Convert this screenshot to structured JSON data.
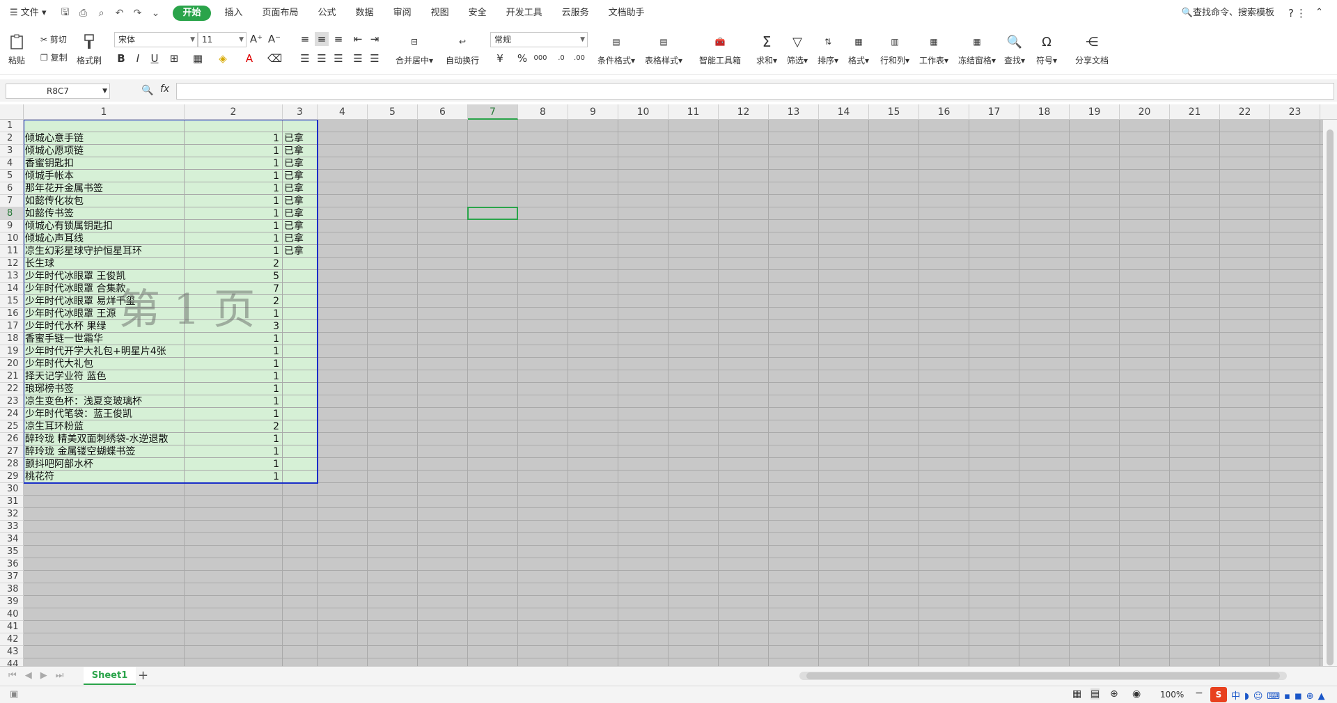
{
  "menu": {
    "file": "文件",
    "tabs": [
      "开始",
      "插入",
      "页面布局",
      "公式",
      "数据",
      "审阅",
      "视图",
      "安全",
      "开发工具",
      "云服务",
      "文档助手"
    ],
    "search": "查找命令、搜索模板"
  },
  "ribbon": {
    "paste": "粘贴",
    "cut": "剪切",
    "copy": "复制",
    "format_painter": "格式刷",
    "font": "宋体",
    "size": "11",
    "number_format": "常规",
    "merge": "合并居中",
    "wrap": "自动换行",
    "cond": "条件格式",
    "table_style": "表格样式",
    "smart": "智能工具箱",
    "sum": "求和",
    "filter": "筛选",
    "sort": "排序",
    "format": "格式",
    "rowcol": "行和列",
    "sheet": "工作表",
    "freeze": "冻结窗格",
    "find": "查找",
    "symbol": "符号",
    "share": "分享文档"
  },
  "namebox": "R8C7",
  "fx": "fx",
  "columns": [
    "1",
    "2",
    "3",
    "4",
    "5",
    "6",
    "7",
    "8",
    "9",
    "10",
    "11",
    "12",
    "13",
    "14",
    "15",
    "16",
    "17",
    "18",
    "19",
    "20",
    "21",
    "22",
    "23"
  ],
  "selected_col": "7",
  "selected_row": "8",
  "rows": [
    [
      "",
      null,
      ""
    ],
    [
      "倾城心意手链",
      1,
      "已拿"
    ],
    [
      "倾城心愿项链",
      1,
      "已拿"
    ],
    [
      "香蜜钥匙扣",
      1,
      "已拿"
    ],
    [
      "倾城手帐本",
      1,
      "已拿"
    ],
    [
      "那年花开金属书签",
      1,
      "已拿"
    ],
    [
      "如懿传化妆包",
      1,
      "已拿"
    ],
    [
      "如懿传书签",
      1,
      "已拿"
    ],
    [
      "倾城心有锁属钥匙扣",
      1,
      "已拿"
    ],
    [
      "倾城心声耳线",
      1,
      "已拿"
    ],
    [
      "凉生幻彩星球守护恒星耳环",
      1,
      "已拿"
    ],
    [
      "长生球",
      2,
      ""
    ],
    [
      "少年时代冰眼罩 王俊凯",
      5,
      ""
    ],
    [
      "少年时代冰眼罩 合集款",
      7,
      ""
    ],
    [
      "少年时代冰眼罩 易烊千玺",
      2,
      ""
    ],
    [
      "少年时代冰眼罩 王源",
      1,
      ""
    ],
    [
      "少年时代水杯 果绿",
      3,
      ""
    ],
    [
      "香蜜手链一世霜华",
      1,
      ""
    ],
    [
      "少年时代开学大礼包+明星片4张",
      1,
      ""
    ],
    [
      "少年时代大礼包",
      1,
      ""
    ],
    [
      "择天记学业符 蓝色",
      1,
      ""
    ],
    [
      "琅琊榜书签",
      1,
      ""
    ],
    [
      "凉生变色杯：浅夏变玻璃杯",
      1,
      ""
    ],
    [
      "少年时代笔袋：蓝王俊凯",
      1,
      ""
    ],
    [
      "凉生耳环粉蓝",
      2,
      ""
    ],
    [
      "醉玲珑 精美双面刺绣袋-水逆退散",
      1,
      ""
    ],
    [
      "醉玲珑 金属镂空蝴蝶书签",
      1,
      ""
    ],
    [
      "颤抖吧阿部水杯",
      1,
      ""
    ],
    [
      "桃花符",
      1,
      ""
    ]
  ],
  "row_count": 44,
  "watermark": "第 1 页",
  "sheet_tab": "Sheet1",
  "zoom": "100%"
}
